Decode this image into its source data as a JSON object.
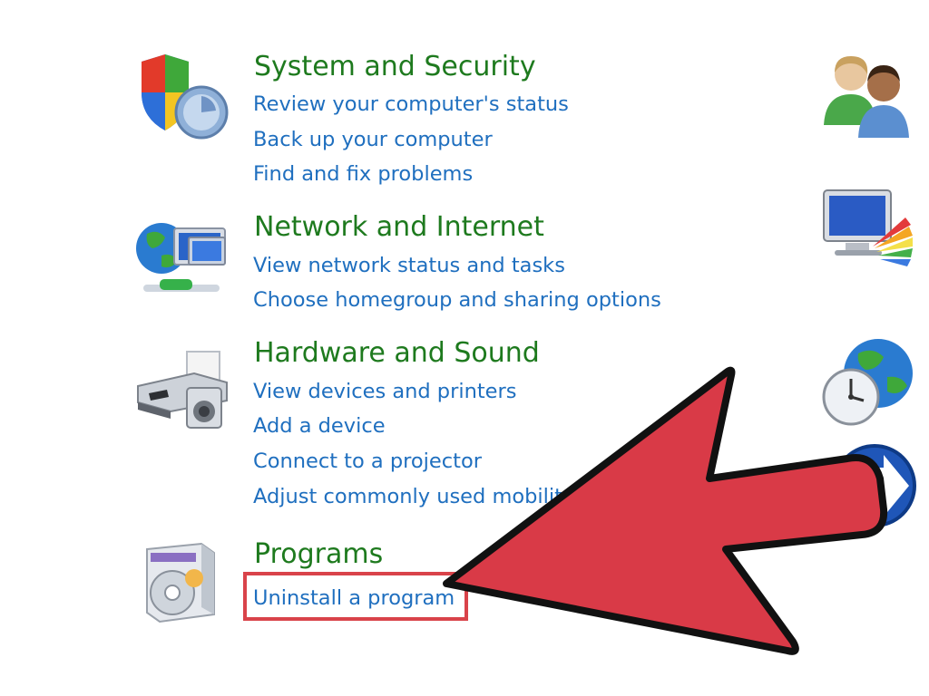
{
  "categories": [
    {
      "title": "System and Security",
      "icon": "shield-icon",
      "links": [
        "Review your computer's status",
        "Back up your computer",
        "Find and fix problems"
      ]
    },
    {
      "title": "Network and Internet",
      "icon": "network-globe-icon",
      "links": [
        "View network status and tasks",
        "Choose homegroup and sharing options"
      ]
    },
    {
      "title": "Hardware and Sound",
      "icon": "printer-icon",
      "links": [
        "View devices and printers",
        "Add a device",
        "Connect to a projector",
        "Adjust commonly used mobility settings"
      ]
    },
    {
      "title": "Programs",
      "icon": "programs-box-icon",
      "links": [
        "Uninstall a program"
      ]
    }
  ],
  "right_icons": [
    "user-accounts-icon",
    "appearance-icon",
    "clock-globe-icon",
    "ease-of-access-icon"
  ],
  "annotation": {
    "highlight": "highlight-box-icon",
    "arrow": "red-arrow-icon",
    "arrow_color": "#d93a47",
    "box_color": "#d9434a"
  },
  "colors": {
    "title": "#1e7a1e",
    "link": "#1f6fbf"
  }
}
